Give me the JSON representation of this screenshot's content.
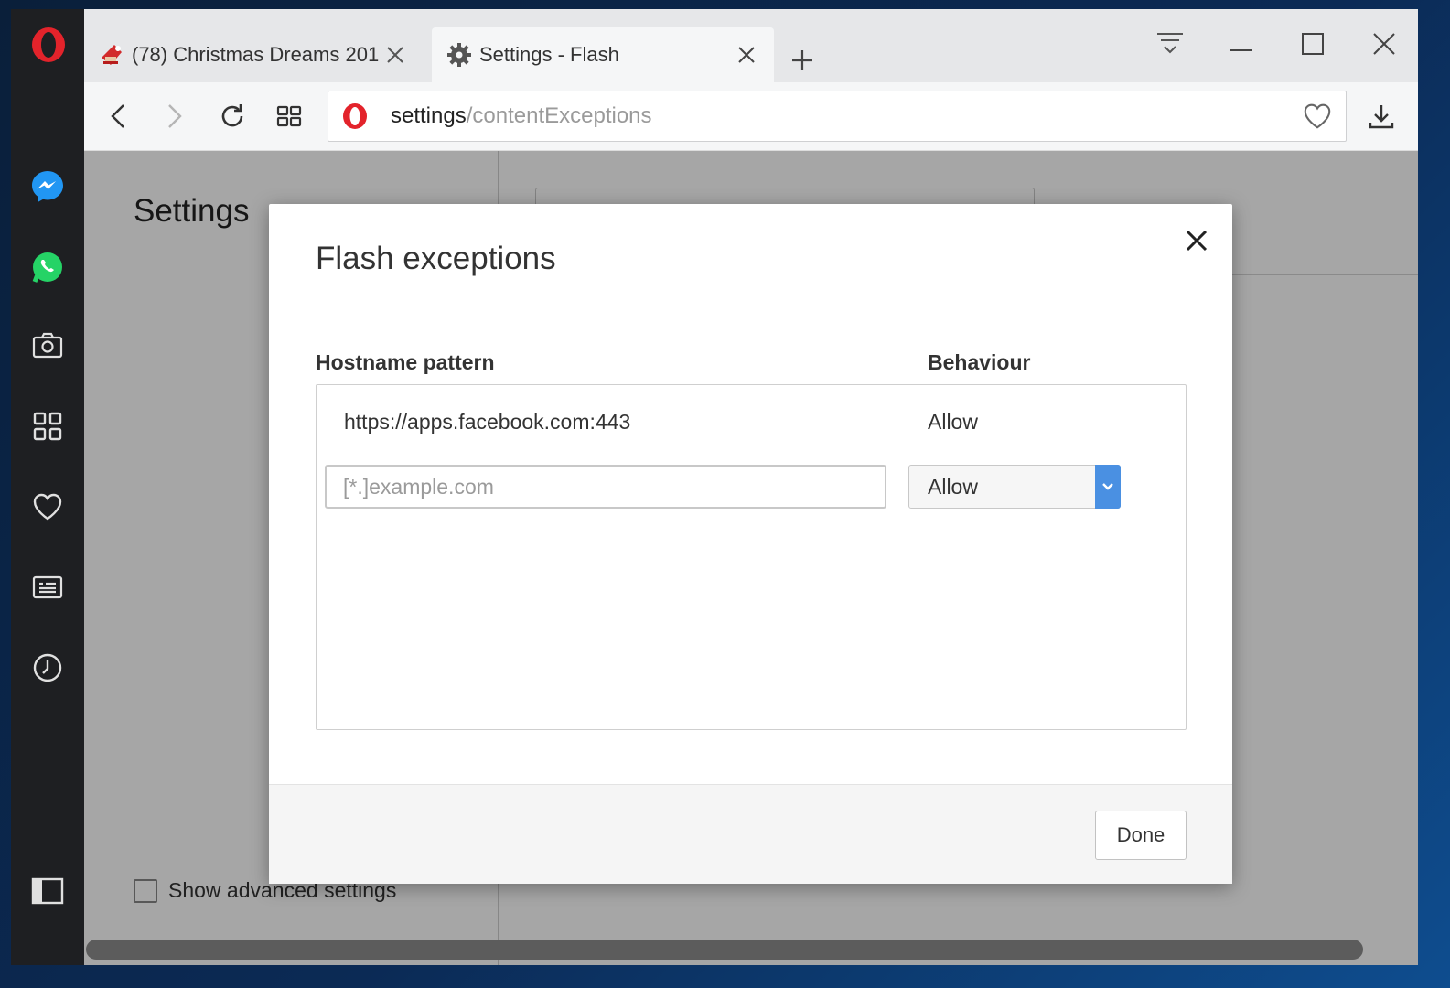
{
  "tabs": [
    {
      "title": "(78) Christmas Dreams 201",
      "icon": "santa-icon",
      "active": false
    },
    {
      "title": "Settings - Flash",
      "icon": "gear-icon",
      "active": true
    }
  ],
  "address_bar": {
    "host": "settings",
    "path": "/contentExceptions"
  },
  "page": {
    "heading": "Settings",
    "advanced_label": "Show advanced settings"
  },
  "dialog": {
    "title": "Flash exceptions",
    "columns": {
      "pattern": "Hostname pattern",
      "behaviour": "Behaviour"
    },
    "exceptions": [
      {
        "pattern": "https://apps.facebook.com:443",
        "behaviour": "Allow"
      }
    ],
    "new_pattern": {
      "placeholder": "[*.]example.com",
      "value": ""
    },
    "behaviour_select": {
      "selected": "Allow"
    },
    "done_label": "Done"
  },
  "colors": {
    "opera_red": "#e3232b",
    "accent_blue": "#4a90e2",
    "sidebar_bg": "#1e1f22"
  }
}
